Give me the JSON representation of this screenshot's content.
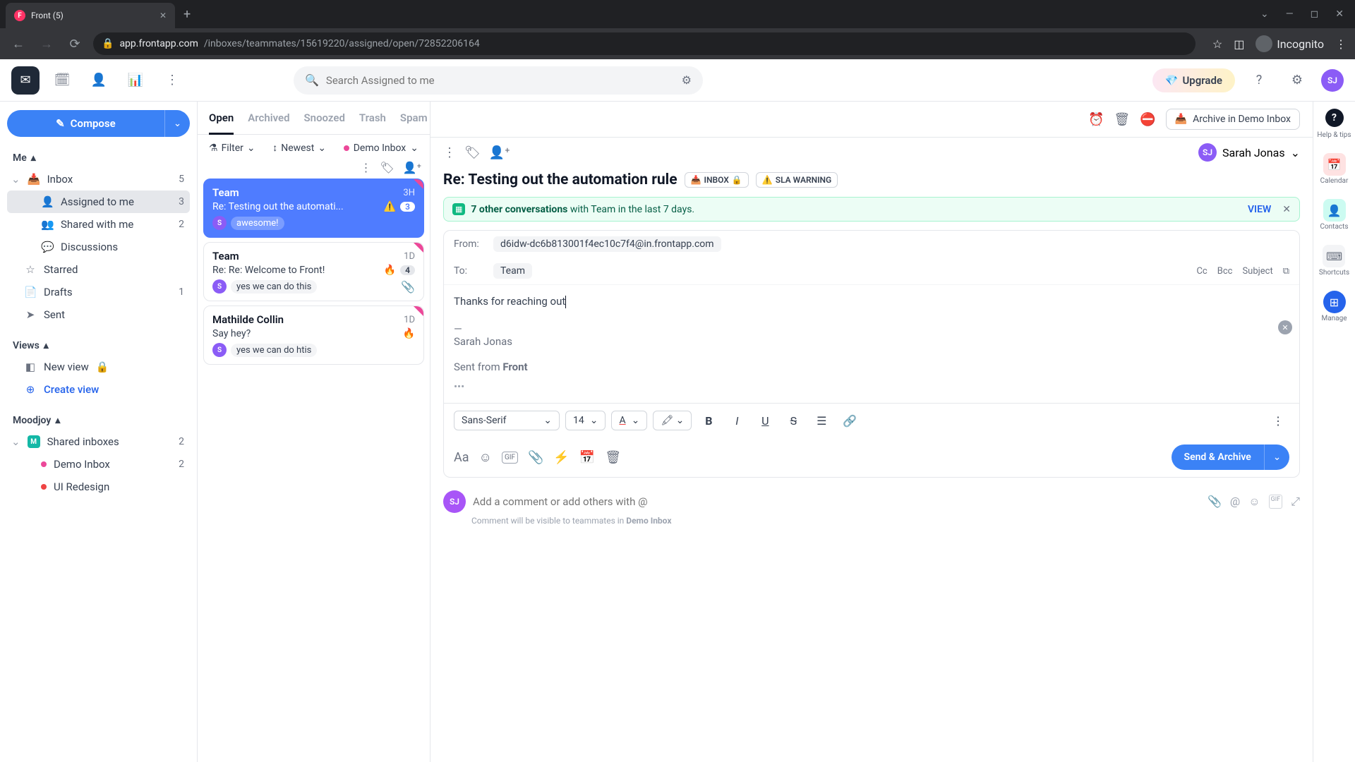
{
  "browser": {
    "tab_title": "Front (5)",
    "url_domain": "app.frontapp.com",
    "url_path": "/inboxes/teammates/15619220/assigned/open/72852206164",
    "incognito": "Incognito"
  },
  "header": {
    "search_placeholder": "Search Assigned to me",
    "upgrade": "Upgrade",
    "avatar_initials": "SJ"
  },
  "sidebar": {
    "compose": "Compose",
    "me_section": "Me",
    "inbox": {
      "label": "Inbox",
      "count": "5"
    },
    "assigned": {
      "label": "Assigned to me",
      "count": "3"
    },
    "shared": {
      "label": "Shared with me",
      "count": "2"
    },
    "discussions": {
      "label": "Discussions"
    },
    "starred": {
      "label": "Starred"
    },
    "drafts": {
      "label": "Drafts",
      "count": "1"
    },
    "sent": {
      "label": "Sent"
    },
    "views_section": "Views",
    "new_view": "New view",
    "create_view": "Create view",
    "moodjoy_section": "Moodjoy",
    "shared_inboxes": {
      "label": "Shared inboxes",
      "count": "2"
    },
    "demo_inbox": {
      "label": "Demo Inbox",
      "count": "2"
    },
    "ui_redesign": {
      "label": "UI Redesign"
    }
  },
  "conv_tabs": {
    "open": "Open",
    "archived": "Archived",
    "snoozed": "Snoozed",
    "trash": "Trash",
    "spam": "Spam"
  },
  "conv_controls": {
    "filter": "Filter",
    "sort": "Newest",
    "inbox_chip": "Demo Inbox"
  },
  "conversations": [
    {
      "sender": "Team",
      "time": "3H",
      "subject": "Re: Testing out the automati...",
      "badge": "3",
      "warn": "⚠️",
      "avatar": "S",
      "preview": "awesome!"
    },
    {
      "sender": "Team",
      "time": "1D",
      "subject": "Re: Re: Welcome to Front!",
      "badge": "4",
      "fire": "🔥",
      "avatar": "S",
      "preview": "yes we can do this",
      "attach": true
    },
    {
      "sender": "Mathilde Collin",
      "time": "1D",
      "subject": "Say hey?",
      "fire": "🔥",
      "avatar": "S",
      "preview": "yes we can do htis"
    }
  ],
  "detail": {
    "archive_btn": "Archive in Demo Inbox",
    "assignee": "Sarah Jonas",
    "assignee_initials": "SJ",
    "subject": "Re: Testing out the automation rule",
    "label_inbox": "INBOX",
    "label_sla": "SLA WARNING",
    "banner_strong": "7 other conversations",
    "banner_rest": " with Team in the last 7 days.",
    "banner_view": "VIEW",
    "from_label": "From:",
    "from_value": "d6idw-dc6b813001f4ec10c7f4@in.frontapp.com",
    "to_label": "To:",
    "to_value": "Team",
    "cc": "Cc",
    "bcc": "Bcc",
    "subject_field": "Subject",
    "body": "Thanks for reaching out",
    "sig_dash": "—",
    "sig_name": "Sarah Jonas",
    "sent_from_prefix": "Sent from ",
    "sent_from_app": "Front",
    "font_family": "Sans-Serif",
    "font_size": "14",
    "send_btn": "Send & Archive",
    "comment_placeholder": "Add a comment or add others with @",
    "comment_hint_prefix": "Comment will be visible to teammates in ",
    "comment_hint_inbox": "Demo Inbox"
  },
  "rail": {
    "help": "Help & tips",
    "calendar": "Calendar",
    "contacts": "Contacts",
    "shortcuts": "Shortcuts",
    "manage": "Manage"
  }
}
